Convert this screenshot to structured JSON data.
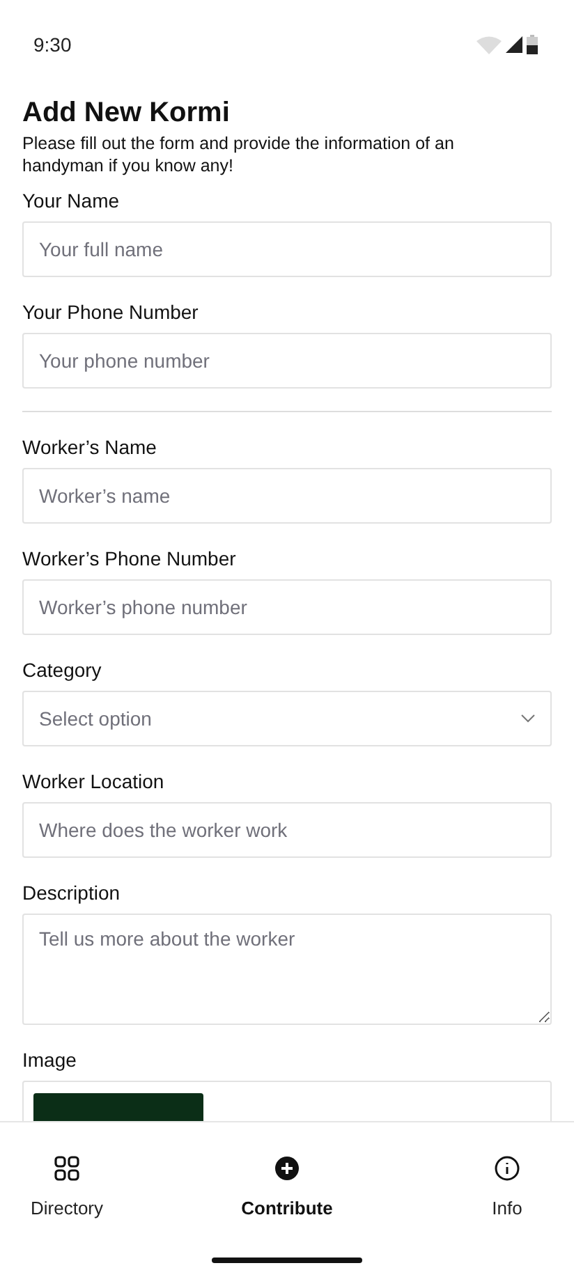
{
  "status_bar": {
    "time": "9:30"
  },
  "header": {
    "title": "Add New Kormi",
    "subtitle": "Please fill out the form and provide the information of an handyman if you know any!"
  },
  "groups": [
    {
      "fields": [
        {
          "kind": "text",
          "label": "Your Name",
          "placeholder": "Your full name"
        },
        {
          "kind": "text",
          "label": "Your Phone Number",
          "placeholder": "Your phone number"
        }
      ]
    },
    {
      "fields": [
        {
          "kind": "text",
          "label": "Worker’s Name",
          "placeholder": "Worker’s name"
        },
        {
          "kind": "text",
          "label": "Worker’s Phone Number",
          "placeholder": "Worker’s phone number"
        },
        {
          "kind": "select",
          "label": "Category",
          "placeholder": "Select option"
        },
        {
          "kind": "text",
          "label": "Worker Location",
          "placeholder": "Where does the worker work"
        },
        {
          "kind": "textarea",
          "label": "Description",
          "placeholder": "Tell us more about the worker"
        },
        {
          "kind": "file",
          "label": "Image"
        }
      ]
    }
  ],
  "nav": [
    {
      "label": "Directory",
      "selected": false
    },
    {
      "label": "Contribute",
      "selected": true
    },
    {
      "label": "Info",
      "selected": false
    }
  ]
}
